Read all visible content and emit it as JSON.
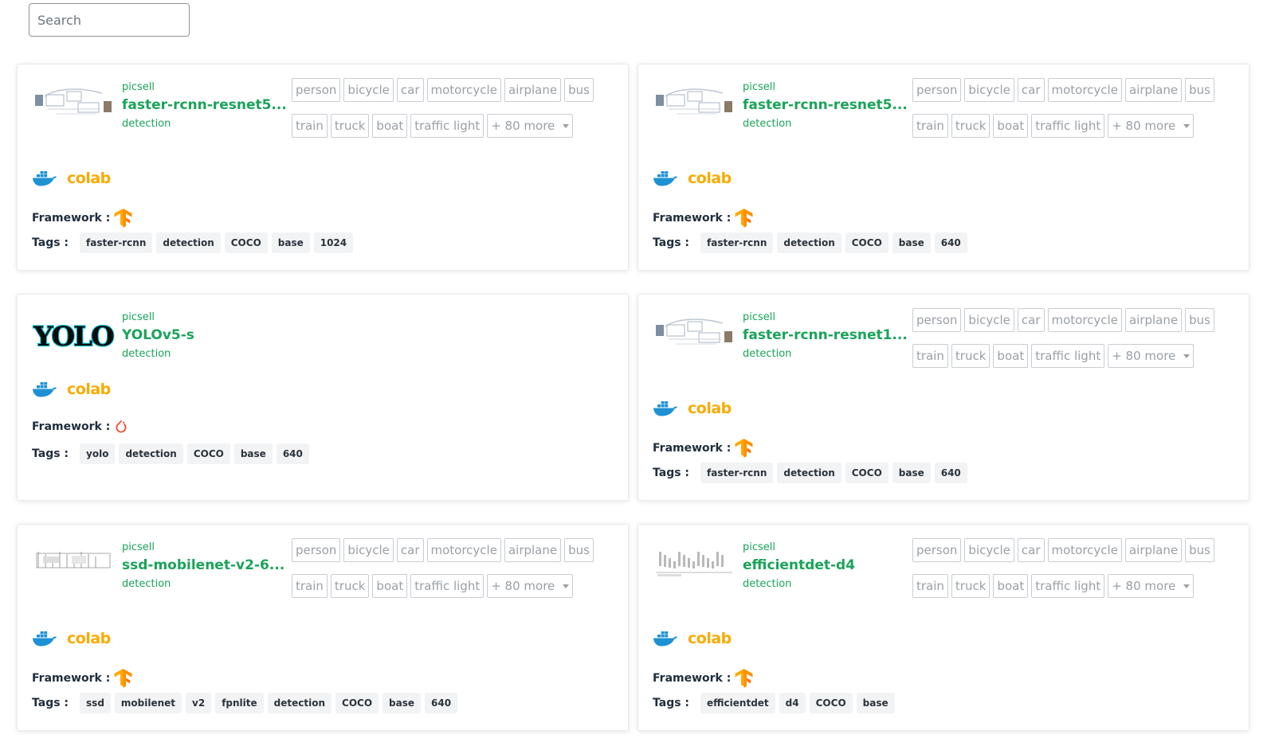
{
  "search": {
    "placeholder": "Search"
  },
  "common": {
    "framework_label": "Framework :",
    "tags_label": "Tags :",
    "colab_label": "colab",
    "more_label": "+ 80 more"
  },
  "labels_row1": [
    "person",
    "bicycle",
    "car",
    "motorcycle",
    "airplane",
    "bus"
  ],
  "labels_row2": [
    "train",
    "truck",
    "boat",
    "traffic light"
  ],
  "colors": {
    "accent_green": "#1aa35a",
    "colab_orange": "#f9ab00",
    "docker_blue": "#1d91d4"
  },
  "cards": [
    {
      "owner": "picsell",
      "name": "faster-rcnn-resnet5...",
      "task": "detection",
      "framework_icon": "tensorflow-icon",
      "tags": [
        "faster-rcnn",
        "detection",
        "COCO",
        "base",
        "1024"
      ]
    },
    {
      "owner": "picsell",
      "name": "faster-rcnn-resnet5...",
      "task": "detection",
      "framework_icon": "tensorflow-icon",
      "tags": [
        "faster-rcnn",
        "detection",
        "COCO",
        "base",
        "640"
      ]
    },
    {
      "owner": "picsell",
      "name": "YOLOv5-s",
      "task": "detection",
      "framework_icon": "pytorch-icon",
      "tags": [
        "yolo",
        "detection",
        "COCO",
        "base",
        "640"
      ]
    },
    {
      "owner": "picsell",
      "name": "faster-rcnn-resnet1...",
      "task": "detection",
      "framework_icon": "tensorflow-icon",
      "tags": [
        "faster-rcnn",
        "detection",
        "COCO",
        "base",
        "640"
      ]
    },
    {
      "owner": "picsell",
      "name": "ssd-mobilenet-v2-6...",
      "task": "detection",
      "framework_icon": "tensorflow-icon",
      "tags": [
        "ssd",
        "mobilenet",
        "v2",
        "fpnlite",
        "detection",
        "COCO",
        "base",
        "640"
      ]
    },
    {
      "owner": "picsell",
      "name": "efficientdet-d4",
      "task": "detection",
      "framework_icon": "tensorflow-icon",
      "tags": [
        "efficientdet",
        "d4",
        "COCO",
        "base"
      ]
    }
  ]
}
